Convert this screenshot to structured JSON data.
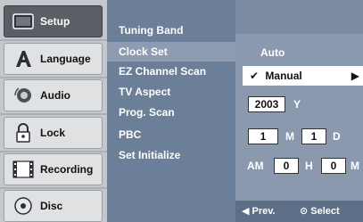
{
  "tabs": [
    {
      "label": "Setup",
      "icon": "monitor-icon"
    },
    {
      "label": "Language",
      "icon": "font-a-icon"
    },
    {
      "label": "Audio",
      "icon": "speaker-icon"
    },
    {
      "label": "Lock",
      "icon": "padlock-icon"
    },
    {
      "label": "Recording",
      "icon": "film-icon"
    },
    {
      "label": "Disc",
      "icon": "disc-icon"
    }
  ],
  "menu": [
    "Tuning Band",
    "Clock Set",
    "EZ Channel Scan",
    "TV Aspect",
    "Prog. Scan",
    "PBC",
    "Set Initialize"
  ],
  "options": {
    "auto": "Auto",
    "manual": "Manual",
    "check": "✔",
    "arrow": "▶"
  },
  "clock": {
    "year": "2003",
    "year_label": "Y",
    "month": "1",
    "month_label": "M",
    "day": "1",
    "day_label": "D",
    "ampm": "AM",
    "hour": "0",
    "hour_label": "H",
    "minute": "0",
    "minute_label": "M"
  },
  "footer": {
    "prev": "◀ Prev.",
    "select": "⊙ Select"
  }
}
